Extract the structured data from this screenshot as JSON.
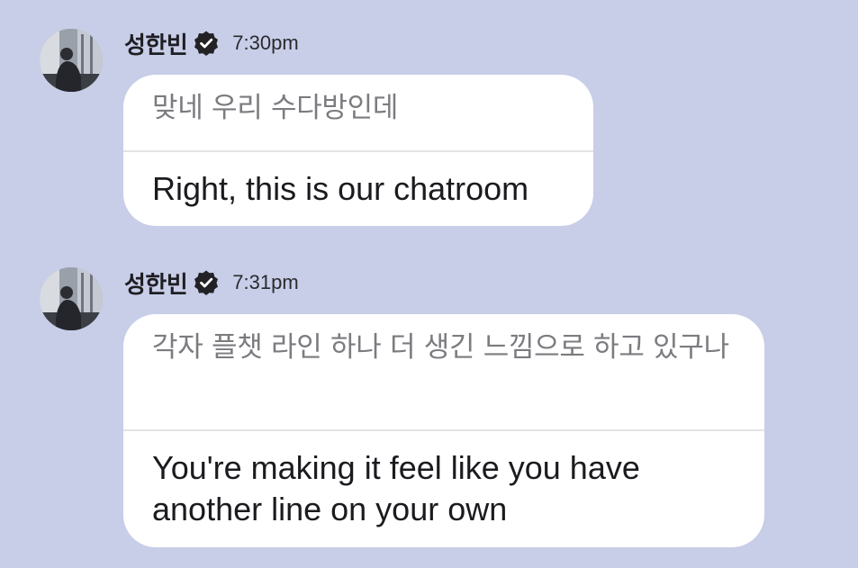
{
  "messages": [
    {
      "sender": "성한빈",
      "time": "7:30pm",
      "original": "맞네 우리 수다방인데",
      "translation": "Right, this is our chatroom"
    },
    {
      "sender": "성한빈",
      "time": "7:31pm",
      "original": "각자 플챗 라인 하나 더 생긴 느낌으로 하고 있구나",
      "translation": "You're making it feel like you have another line on your own"
    }
  ],
  "colors": {
    "background": "#c8cee8",
    "bubble": "#ffffff",
    "original_text": "#7b7b80",
    "translation_text": "#1b1b1f",
    "verified_badge": "#222226"
  },
  "icons": {
    "verified": "verified-badge-icon",
    "avatar": "profile-photo-silhouette-by-window"
  }
}
